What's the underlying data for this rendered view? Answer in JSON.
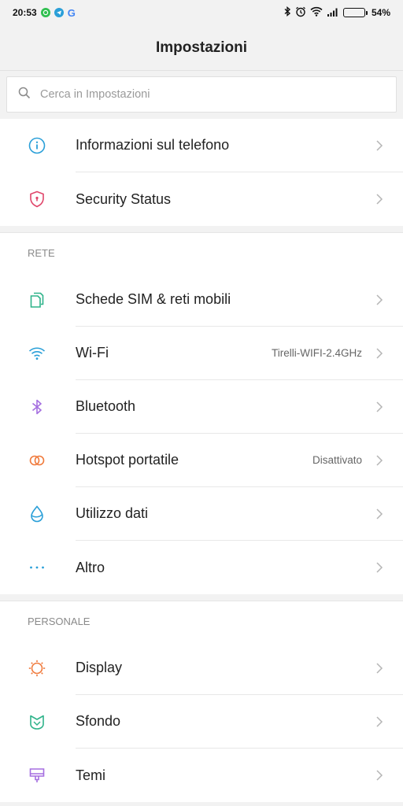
{
  "status_bar": {
    "time": "20:53",
    "battery": "54%",
    "battery_level": 0.54,
    "notification_icons": [
      "whatsapp-icon",
      "telegram-icon",
      "google-icon"
    ],
    "system_icons": [
      "bluetooth-icon",
      "alarm-icon",
      "wifi-icon",
      "signal-icon",
      "battery-icon"
    ],
    "google_letter": "G"
  },
  "header": {
    "title": "Impostazioni"
  },
  "search": {
    "placeholder": "Cerca in Impostazioni"
  },
  "groups": {
    "top": {
      "items": [
        {
          "label": "Informazioni sul telefono",
          "icon": "info-icon",
          "color": "#2a9fd8"
        },
        {
          "label": "Security Status",
          "icon": "shield-icon",
          "color": "#e0456a"
        }
      ]
    },
    "rete": {
      "header": "RETE",
      "items": [
        {
          "label": "Schede SIM & reti mobili",
          "icon": "sim-icon",
          "color": "#2fb38a"
        },
        {
          "label": "Wi-Fi",
          "value": "Tirelli-WIFI-2.4GHz",
          "icon": "wifi-icon",
          "color": "#2a9fd8"
        },
        {
          "label": "Bluetooth",
          "icon": "bluetooth-icon",
          "color": "#a56fe0"
        },
        {
          "label": "Hotspot portatile",
          "value": "Disattivato",
          "icon": "hotspot-icon",
          "color": "#f07a3c"
        },
        {
          "label": "Utilizzo dati",
          "icon": "data-drop-icon",
          "color": "#2a9fd8"
        },
        {
          "label": "Altro",
          "icon": "more-dots-icon",
          "color": "#2a9fd8"
        }
      ]
    },
    "personale": {
      "header": "PERSONALE",
      "items": [
        {
          "label": "Display",
          "icon": "sun-icon",
          "color": "#f07a3c"
        },
        {
          "label": "Sfondo",
          "icon": "wallpaper-icon",
          "color": "#2fb38a"
        },
        {
          "label": "Temi",
          "icon": "theme-brush-icon",
          "color": "#a56fe0"
        }
      ]
    }
  }
}
